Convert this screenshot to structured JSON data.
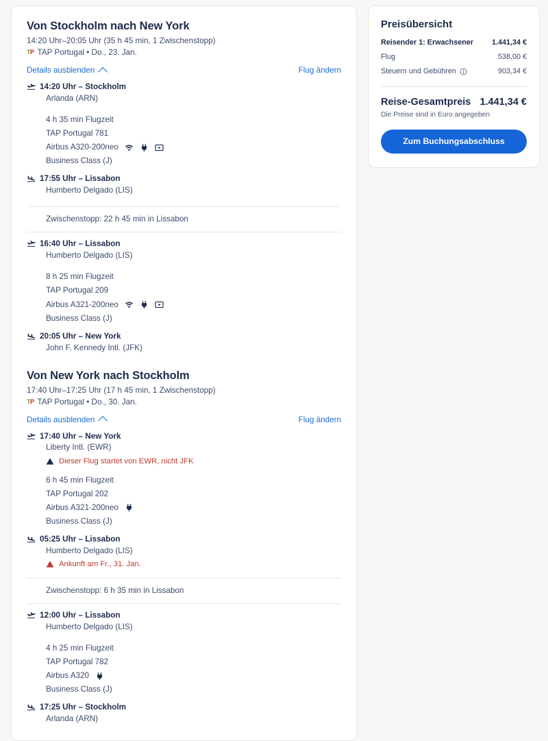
{
  "itinerary": {
    "legs": [
      {
        "title": "Von Stockholm nach New York",
        "times": "14:20 Uhr–20:05 Uhr (35 h 45 min, 1 Zwischenstopp)",
        "airline_logo_t": "T",
        "airline_logo_p": "P",
        "airline_line": "TAP Portugal • Do., 23. Jan.",
        "details_toggle": "Details ausblenden",
        "change_flight": "Flug ändern",
        "segments": [
          {
            "departure_time_city": "14:20 Uhr – Stockholm",
            "departure_airport": "Arlanda (ARN)",
            "duration": "4 h 35 min Flugzeit",
            "flight_number": "TAP Portugal 781",
            "aircraft": "Airbus A320-200neo",
            "amenities": [
              "wifi-icon",
              "power-icon",
              "entertainment-icon"
            ],
            "cabin": "Business Class (J)",
            "arrival_time_city": "17:55 Uhr – Lissabon",
            "arrival_airport": "Humberto Delgado (LIS)"
          },
          {
            "departure_time_city": "16:40 Uhr – Lissabon",
            "departure_airport": "Humberto Delgado (LIS)",
            "duration": "8 h 25 min Flugzeit",
            "flight_number": "TAP Portugal 209",
            "aircraft": "Airbus A321-200neo",
            "amenities": [
              "wifi-icon",
              "power-icon",
              "entertainment-icon"
            ],
            "cabin": "Business Class (J)",
            "arrival_time_city": "20:05 Uhr – New York",
            "arrival_airport": "John F. Kennedy Intl. (JFK)"
          }
        ],
        "layover": "Zwischenstopp: 22 h 45 min in Lissabon"
      },
      {
        "title": "Von New York nach Stockholm",
        "times": "17:40 Uhr–17:25 Uhr (17 h 45 min, 1 Zwischenstopp)",
        "airline_logo_t": "T",
        "airline_logo_p": "P",
        "airline_line": "TAP Portugal • Do., 30. Jan.",
        "details_toggle": "Details ausblenden",
        "change_flight": "Flug ändern",
        "segments": [
          {
            "departure_time_city": "17:40 Uhr – New York",
            "departure_airport": "Liberty Intl. (EWR)",
            "departure_alert": "Dieser Flug startet von EWR, nicht JFK",
            "duration": "6 h 45 min Flugzeit",
            "flight_number": "TAP Portugal 202",
            "aircraft": "Airbus A321-200neo",
            "amenities": [
              "power-icon"
            ],
            "cabin": "Business Class (J)",
            "arrival_time_city": "05:25 Uhr – Lissabon",
            "arrival_airport": "Humberto Delgado (LIS)",
            "arrival_alert": "Ankunft am Fr., 31. Jan."
          },
          {
            "departure_time_city": "12:00 Uhr – Lissabon",
            "departure_airport": "Humberto Delgado (LIS)",
            "duration": "4 h 25 min Flugzeit",
            "flight_number": "TAP Portugal 782",
            "aircraft": "Airbus A320",
            "amenities": [
              "power-icon"
            ],
            "cabin": "Business Class (J)",
            "arrival_time_city": "17:25 Uhr – Stockholm",
            "arrival_airport": "Arlanda (ARN)"
          }
        ],
        "layover": "Zwischenstopp: 6 h 35 min in Lissabon"
      }
    ]
  },
  "summary": {
    "title": "Preisübersicht",
    "rows": [
      {
        "label": "Reisender 1: Erwachsener",
        "value": "1.441,34 €",
        "strong": true,
        "info": false
      },
      {
        "label": "Flug",
        "value": "538,00 €",
        "strong": false,
        "info": false
      },
      {
        "label": "Steuern und Gebühren",
        "value": "903,34 €",
        "strong": false,
        "info": true
      }
    ],
    "total_label": "Reise-Gesamtpreis",
    "total_value": "1.441,34 €",
    "currency_note": "Die Preise sind in Euro angegeben",
    "cta_label": "Zum Buchungsabschluss"
  },
  "colors": {
    "accent_blue": "#1565d8",
    "link_blue": "#1a6dd4",
    "text_navy": "#1f2b4d",
    "alert_red": "#c0392f",
    "page_bg": "#f7f7f7"
  }
}
